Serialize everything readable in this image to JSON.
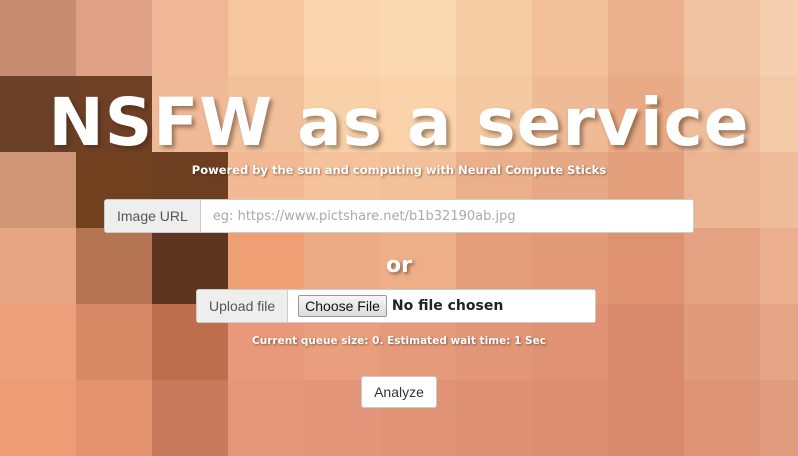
{
  "title": "NSFW as a service",
  "subtitle": "Powered by the sun and computing with Neural Compute Sticks",
  "url_field": {
    "label": "Image URL",
    "placeholder": "eg: https://www.pictshare.net/b1b32190ab.jpg",
    "value": ""
  },
  "separator": "or",
  "file_field": {
    "label": "Upload file",
    "button_label": "Choose File",
    "status": "No file chosen"
  },
  "queue_status": "Current queue size: 0. Estimated wait time: 1 Sec",
  "analyze_label": "Analyze",
  "background_colors": [
    [
      "#c68d72",
      "#dfa185",
      "#f0b896",
      "#f6c6a1",
      "#fbd5ad",
      "#fad9b1",
      "#f6cca4",
      "#f2c19c",
      "#eab08e",
      "#f1c3a2",
      "#f6cfb0"
    ],
    [
      "#6b4029",
      "#704026",
      "#f0ba98",
      "#f2c19c",
      "#f8d1a9",
      "#fad3ab",
      "#f4c9a1",
      "#efbb96",
      "#e9ab85",
      "#efbe9c",
      "#f3c9a8"
    ],
    [
      "#cf9777",
      "#70401f",
      "#6d3e20",
      "#f2b994",
      "#f5c29b",
      "#f3c09a",
      "#ebb08b",
      "#e7a985",
      "#e39f7c",
      "#ebb493",
      "#efbd9c"
    ],
    [
      "#e7a683",
      "#b57452",
      "#5d3520",
      "#ef9f74",
      "#ecaa85",
      "#eeae88",
      "#e39d7a",
      "#e39a77",
      "#de9272",
      "#e5a283",
      "#ebae8f"
    ],
    [
      "#eea07a",
      "#d88a66",
      "#bd6f4d",
      "#e8987b",
      "#e99f7e",
      "#e59b7b",
      "#e29678",
      "#df9374",
      "#d9896c",
      "#e09b7c",
      "#e5a486"
    ],
    [
      "#ee9c76",
      "#e69371",
      "#c97a5d",
      "#e5977c",
      "#e4967a",
      "#e19376",
      "#de9074",
      "#dc8e72",
      "#d98a6e",
      "#dd9477",
      "#e19b7e"
    ]
  ]
}
